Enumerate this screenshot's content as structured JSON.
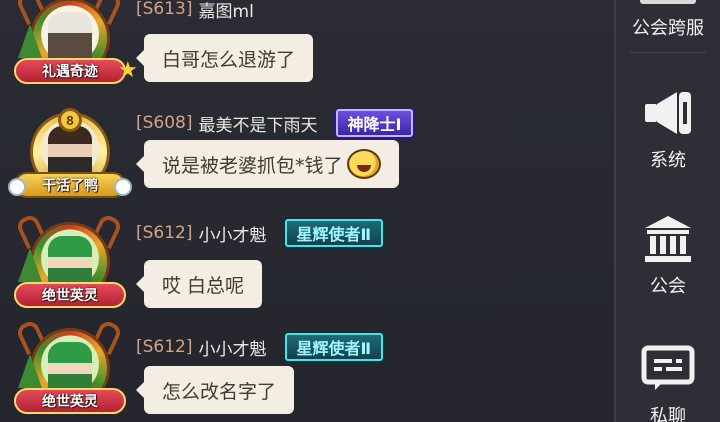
{
  "messages": [
    {
      "server": "[S613]",
      "name": "嘉图ml",
      "badge": "",
      "text": "白哥怎么退游了",
      "frame_title": "礼遇奇迹",
      "frame_level": ""
    },
    {
      "server": "[S608]",
      "name": "最美不是下雨天",
      "badge": "神降士Ⅰ",
      "text": "说是被老婆抓包*钱了",
      "frame_title": "干活了鸭",
      "frame_level": "8"
    },
    {
      "server": "[S612]",
      "name": "小小才魁",
      "badge": "星辉使者Ⅱ",
      "text": "哎  白总呢",
      "frame_title": "绝世英灵",
      "frame_level": ""
    },
    {
      "server": "[S612]",
      "name": "小小才魁",
      "badge": "星辉使者Ⅱ",
      "text": "怎么改名字了",
      "frame_title": "绝世英灵",
      "frame_level": ""
    }
  ],
  "sidebar": {
    "top_label": "公会跨服",
    "items": [
      {
        "label": "系统",
        "icon": "megaphone-icon"
      },
      {
        "label": "公会",
        "icon": "guild-hall-icon"
      },
      {
        "label": "私聊",
        "icon": "chat-bubble-icon"
      }
    ]
  },
  "colors": {
    "server_tag": "#d3a485",
    "bubble": "#f3ede3",
    "badge_purple": "#6c4fe0",
    "badge_teal": "#4fe0e6"
  }
}
